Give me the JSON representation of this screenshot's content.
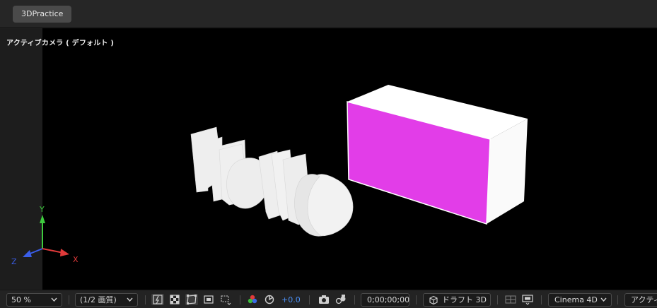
{
  "tab": {
    "label": "3DPractice"
  },
  "viewer": {
    "camera_label": "アクティブカメラ ( デフォルト )",
    "colors": {
      "box_face": "#e23de8",
      "solid": "#efefef",
      "background": "#000000"
    }
  },
  "axes": {
    "x": "X",
    "y": "Y",
    "z": "Z",
    "colors": {
      "x": "#e03a3a",
      "y": "#3ecb3e",
      "z": "#3a5ee8"
    }
  },
  "toolbar": {
    "zoom": "50 %",
    "resolution": "(1/2 画質)",
    "exposure": "+0.0",
    "timecode": "0;00;00;00",
    "draft": "ドラフト 3D",
    "renderer": "Cinema 4D",
    "view": "アクティ"
  }
}
